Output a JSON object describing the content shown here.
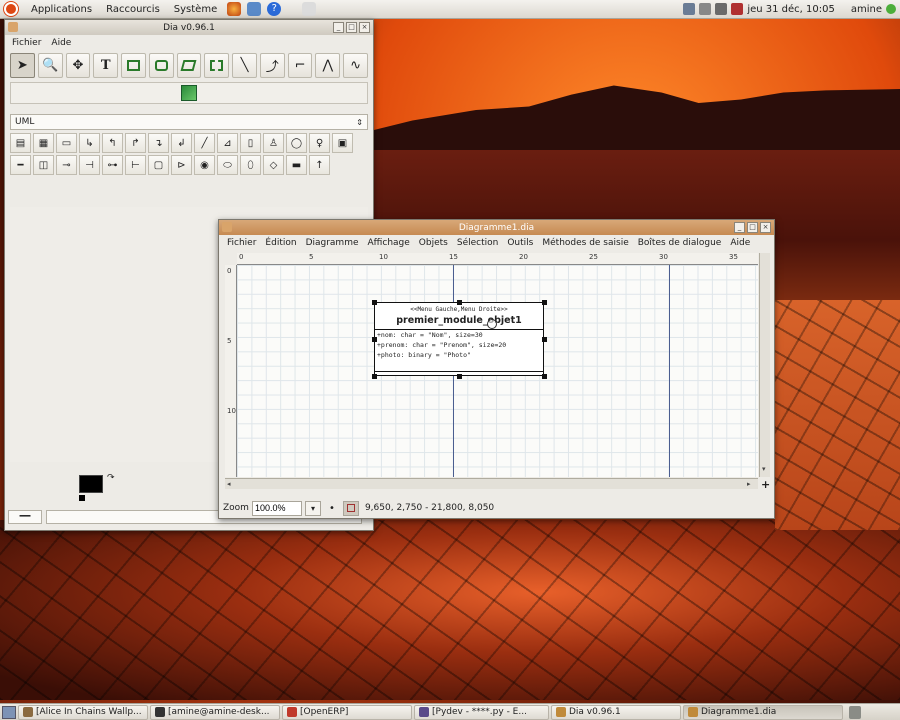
{
  "top_panel": {
    "menus": [
      "Applications",
      "Raccourcis",
      "Système"
    ],
    "clock": "jeu 31 déc, 10:05",
    "user": "amine"
  },
  "toolbox": {
    "title": "Dia v0.96.1",
    "menu": [
      "Fichier",
      "Aide"
    ],
    "sheet": "UML"
  },
  "diagram": {
    "title": "Diagramme1.dia",
    "menu": [
      "Fichier",
      "Édition",
      "Diagramme",
      "Affichage",
      "Objets",
      "Sélection",
      "Outils",
      "Méthodes de saisie",
      "Boîtes de dialogue",
      "Aide"
    ],
    "ruler_h": [
      "0",
      "5",
      "10",
      "15",
      "20",
      "25",
      "30",
      "35"
    ],
    "ruler_v": [
      "0",
      "5",
      "10"
    ],
    "uml_class": {
      "stereotype": "<<Menu Gauche,Menu Droite>>",
      "name": "premier_module_objet1",
      "attributes": [
        "+nom: char = \"Nom\", size=30",
        "+prenom: char = \"Prenom\", size=20",
        "+photo: binary = \"Photo\""
      ]
    },
    "status": {
      "zoom_label": "Zoom",
      "zoom_value": "100.0%",
      "coords": "9,650, 2,750 - 21,800, 8,050"
    }
  },
  "taskbar": {
    "items": [
      {
        "label": "[Alice In Chains Wallp...",
        "icon_color": "#8a6a40"
      },
      {
        "label": "[amine@amine-desk...",
        "icon_color": "#333333"
      },
      {
        "label": "[OpenERP]",
        "icon_color": "#c0392b"
      },
      {
        "label": "[Pydev - ****.py - E...",
        "icon_color": "#5a4a8a"
      },
      {
        "label": "Dia v0.96.1",
        "icon_color": "#c08a3a"
      },
      {
        "label": "Diagramme1.dia",
        "icon_color": "#c08a3a"
      }
    ]
  }
}
